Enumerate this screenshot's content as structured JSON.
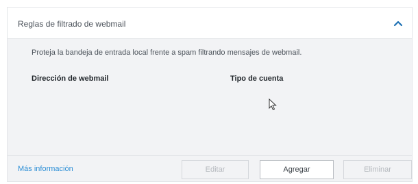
{
  "panel": {
    "title": "Reglas de filtrado de webmail",
    "collapse_icon": "chevron-up-icon",
    "description": "Proteja la bandeja de entrada local frente a spam filtrando mensajes de webmail.",
    "columns": [
      "Dirección de webmail",
      "Tipo de cuenta"
    ],
    "rows": []
  },
  "footer": {
    "more_info": "Más información",
    "edit_label": "Editar",
    "add_label": "Agregar",
    "delete_label": "Eliminar"
  },
  "colors": {
    "link": "#2d8fd6",
    "chevron": "#1b6fb3",
    "panel_bg": "#f2f3f5",
    "disabled_text": "#b4b8bd"
  }
}
